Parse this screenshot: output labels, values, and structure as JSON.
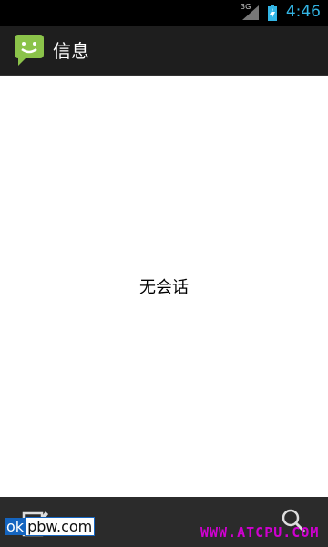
{
  "status_bar": {
    "network": "3G",
    "time": "4:46",
    "accent_color": "#33b5e5"
  },
  "action_bar": {
    "title": "信息",
    "icon": "messaging-app-icon"
  },
  "content": {
    "empty_text": "无会话"
  },
  "bottom_bar": {
    "compose_icon": "compose-icon",
    "search_icon": "search-icon"
  },
  "watermarks": {
    "left_prefix": "ok",
    "left_rest": "pbw.com",
    "right": "WWW.ATCPU.COM"
  }
}
